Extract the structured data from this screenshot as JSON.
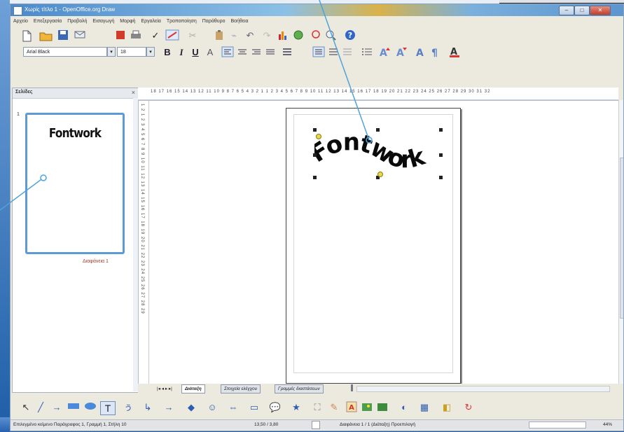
{
  "window": {
    "title": "Χωρίς τίτλο 1 - OpenOffice.org Draw",
    "buttons": {
      "minimize": "–",
      "maximize": "□",
      "close": "✕"
    }
  },
  "menubar": {
    "items": [
      "Αρχείο",
      "Επεξεργασία",
      "Προβολή",
      "Εισαγωγή",
      "Μορφή",
      "Εργαλεία",
      "Τροποποίηση",
      "Παράθυρο",
      "Βοήθεια"
    ]
  },
  "formatting": {
    "font_name": "Arial Black",
    "font_size": "18"
  },
  "panel": {
    "title": "Σελίδες",
    "close": "×",
    "slide_number": "1",
    "slide_label": "Διαφάνεια 1",
    "thumbnail_text": "Fontwork"
  },
  "canvas": {
    "fontwork_text": "Fontwork",
    "hruler": "18 17 16 15 14 13 12 11 10 9 8 7 6 5 4 3 2 1 1 2 3 4 5 6 7 8 9 10 11 12 13 14 15 16 17 18 19 20 21 22 23 24 25 26 27 28 29 30 31 32",
    "vruler": "1 2 1 2 3 4 5 6 7 8 9 10 11 12 13 14 15 16 17 18 19 20 21 22 23 24 25 26 27 28 29"
  },
  "tabs": {
    "nav": "|◂ ◂ ▸ ▸|",
    "items": [
      "Διάταξη",
      "Στοιχεία ελέγχου",
      "Γραμμές διαστάσεων"
    ]
  },
  "statusbar": {
    "left": "Επιλεγμένο κείμενο Παράγραφος 1, Γραμμή 1, Στήλη 10",
    "position": "13,50 / 3,80",
    "size": "",
    "page": "Διαφάνεια 1 / 1 (Διάταξη) Προεπιλογή",
    "zoom": "44%"
  },
  "icons": {
    "new": "new-document-icon",
    "open": "open-folder-icon",
    "save": "save-icon",
    "help": "help-icon"
  },
  "colors": {
    "selection": "#5c9bd6",
    "callout": "#4fa3d8",
    "handle_yellow": "#e9d84a"
  }
}
